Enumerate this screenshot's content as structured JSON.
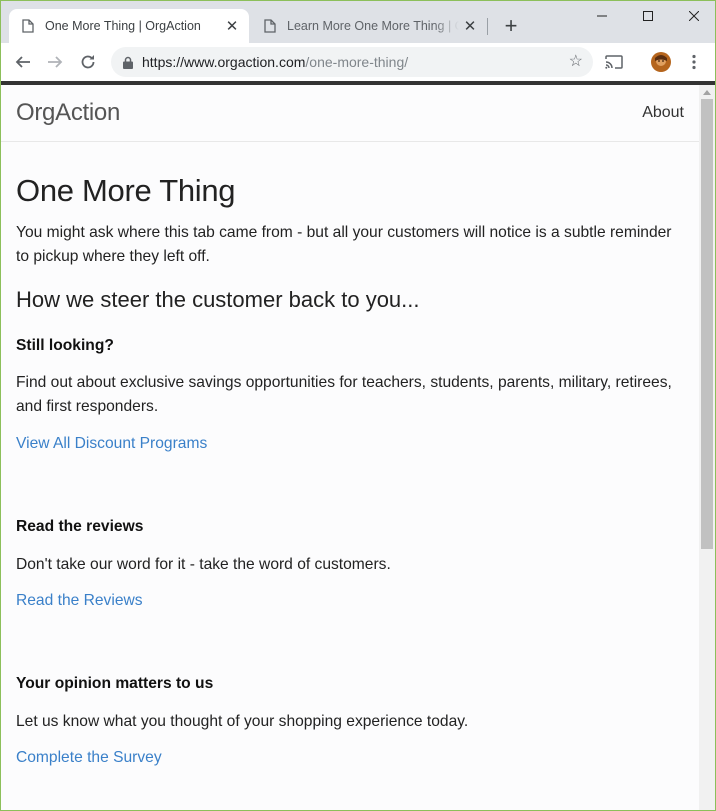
{
  "browser": {
    "tabs": [
      {
        "title": "One More Thing | OrgAction",
        "active": true
      },
      {
        "title": "Learn More One More Thing | OrgAction",
        "active": false
      }
    ],
    "url_host": "https://www.orgaction.com",
    "url_path": "/one-more-thing/"
  },
  "page": {
    "brand": "OrgAction",
    "nav_about": "About",
    "title": "One More Thing",
    "intro": "You might ask where this tab came from - but all your customers will notice is a subtle reminder to pickup where they left off.",
    "subtitle": "How we steer the customer back to you...",
    "sections": [
      {
        "heading": "Still looking?",
        "text": "Find out about exclusive savings opportunities for teachers, students, parents, military, retirees, and first responders.",
        "link": "View All Discount Programs"
      },
      {
        "heading": "Read the reviews",
        "text": "Don't take our word for it - take the word of customers.",
        "link": "Read the Reviews"
      },
      {
        "heading": "Your opinion matters to us",
        "text": "Let us know what you thought of your shopping experience today.",
        "link": "Complete the Survey"
      }
    ]
  },
  "colors": {
    "link": "#3a80c9",
    "window_border": "#8cbf5a",
    "tabstrip": "#dee1e6"
  }
}
